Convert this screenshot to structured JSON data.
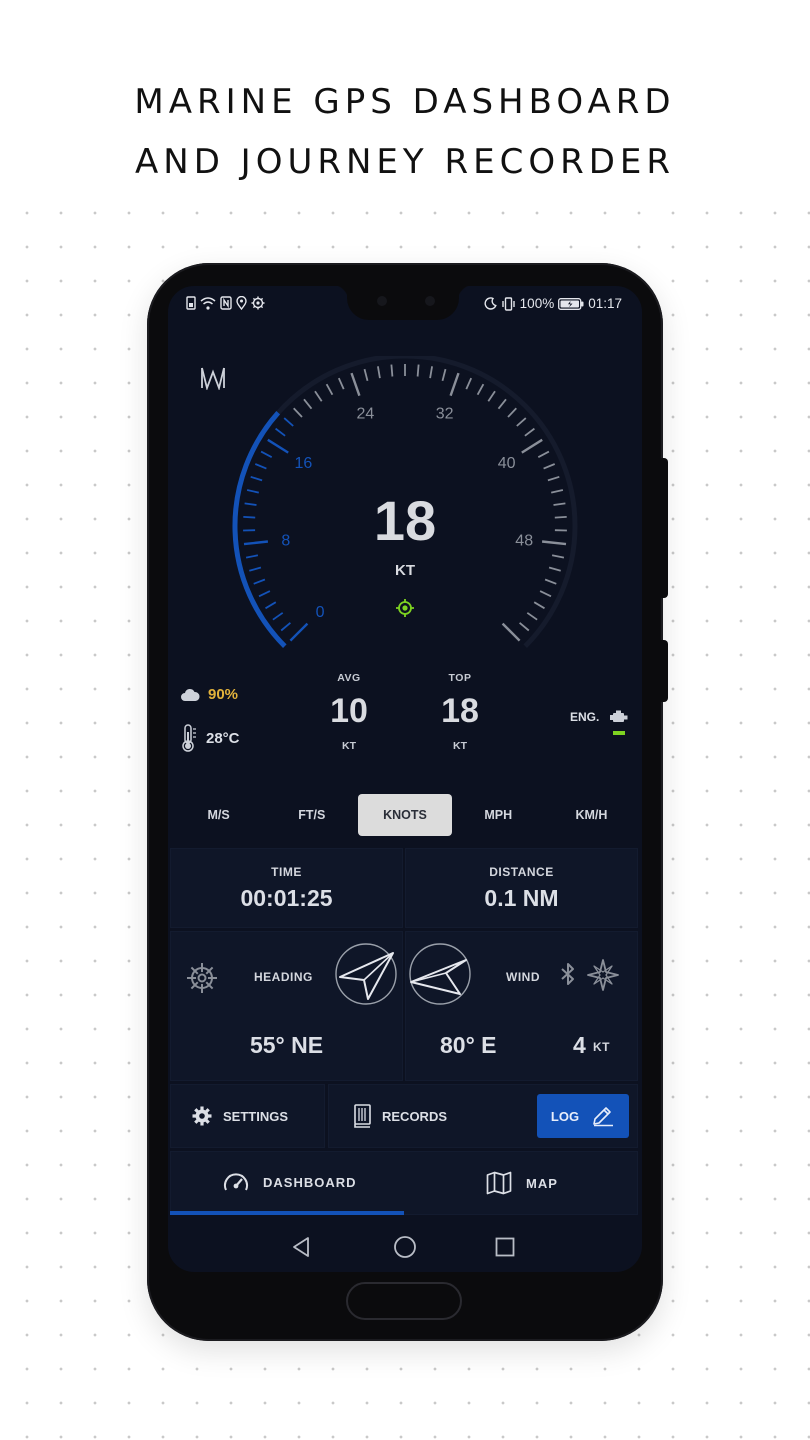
{
  "promo": {
    "line1": "MARINE GPS DASHBOARD",
    "line2": "AND JOURNEY RECORDER"
  },
  "status_bar": {
    "battery": "100%",
    "time": "01:17",
    "left_icons": [
      "sim-icon",
      "wifi-icon",
      "nfc-icon",
      "location-icon",
      "settings-icon"
    ],
    "right_icons": [
      "moon-icon",
      "vibrate-icon",
      "battery-icon"
    ]
  },
  "gauge": {
    "speed": "18",
    "unit": "KT",
    "max": 56,
    "filled": 18,
    "tick_labels": [
      "0",
      "8",
      "16",
      "24",
      "32",
      "40",
      "48"
    ],
    "active_labels": 3,
    "colors": {
      "active": "#1352b8",
      "inactive": "#8a8f99",
      "accent": "#7ed321"
    }
  },
  "stats": {
    "avg": {
      "label": "AVG",
      "value": "10",
      "unit": "KT"
    },
    "top": {
      "label": "TOP",
      "value": "18",
      "unit": "KT"
    }
  },
  "weather": {
    "humidity": "90%",
    "temperature": "28°C"
  },
  "engine": {
    "label": "ENG."
  },
  "units": {
    "items": [
      "M/S",
      "FT/S",
      "KNOTS",
      "MPH",
      "KM/H"
    ],
    "selected": "KNOTS"
  },
  "time": {
    "label": "TIME",
    "value": "00:01:25"
  },
  "distance": {
    "label": "DISTANCE",
    "value": "0.1 NM"
  },
  "heading": {
    "label": "HEADING",
    "value": "55° NE"
  },
  "wind": {
    "label": "WIND",
    "direction": "80° E",
    "speed": "4",
    "unit": "KT"
  },
  "actions": {
    "settings": "SETTINGS",
    "records": "RECORDS",
    "log": "LOG"
  },
  "tabs": {
    "dashboard": "DASHBOARD",
    "map": "MAP",
    "selected": "DASHBOARD"
  }
}
